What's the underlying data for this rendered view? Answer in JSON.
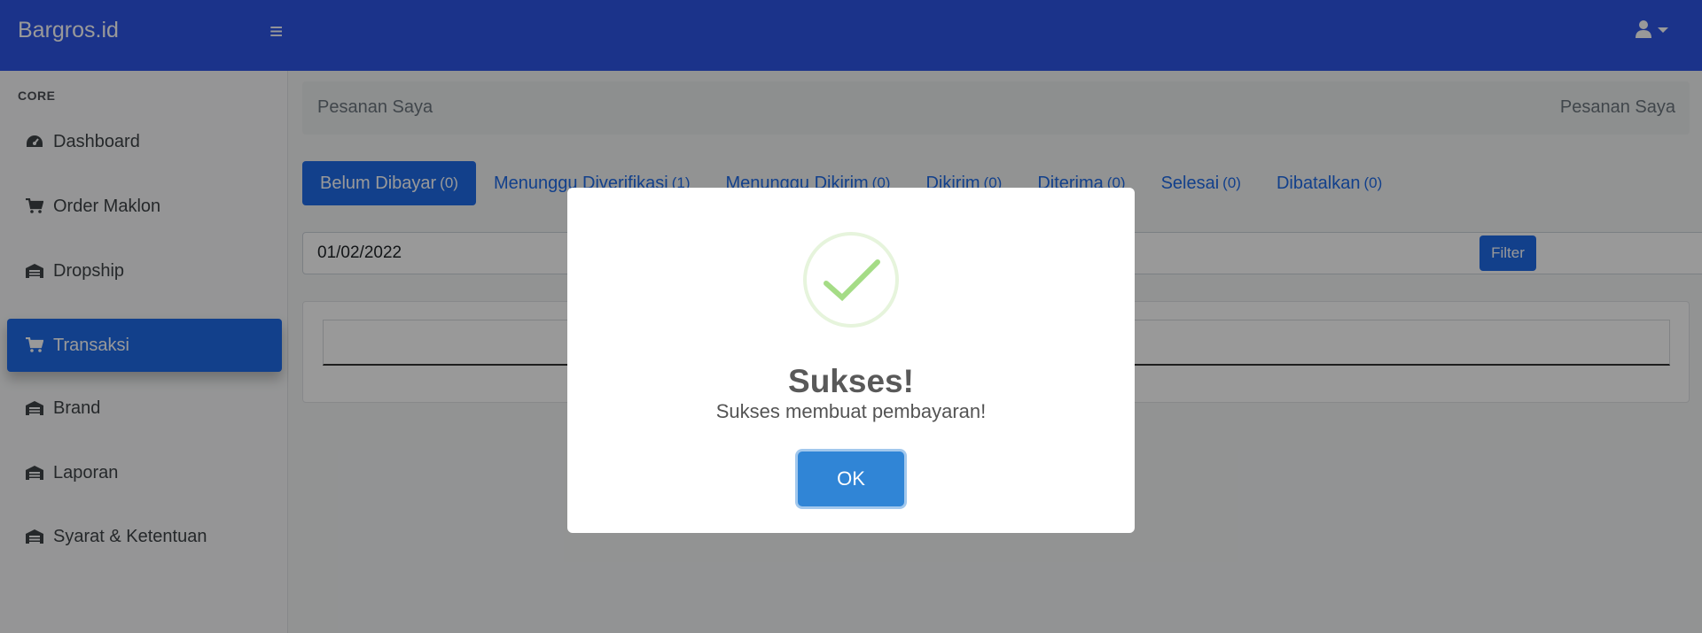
{
  "app": {
    "brand": "Bargros.id",
    "menu_icon": "hamburger-icon",
    "user_icon": "user-icon"
  },
  "colors": {
    "navbar": "#2e55e6",
    "accent": "#1f6be8",
    "ok_button": "#3085d6",
    "success_check": "#a5dc86"
  },
  "sidebar": {
    "heading": "CORE",
    "items": [
      {
        "label": "Dashboard",
        "icon": "dashboard-icon",
        "active": false
      },
      {
        "label": "Order Maklon",
        "icon": "cart-icon",
        "active": false
      },
      {
        "label": "Dropship",
        "icon": "warehouse-icon",
        "active": false
      },
      {
        "label": "Transaksi",
        "icon": "cart-icon",
        "active": true
      },
      {
        "label": "Brand",
        "icon": "warehouse-icon",
        "active": false
      },
      {
        "label": "Laporan",
        "icon": "warehouse-icon",
        "active": false
      },
      {
        "label": "Syarat & Ketentuan",
        "icon": "warehouse-icon",
        "active": false
      }
    ]
  },
  "breadcrumb": {
    "left": "Pesanan Saya",
    "right": "Pesanan Saya"
  },
  "tabs": [
    {
      "label": "Belum Dibayar",
      "count": "(0)",
      "active": true
    },
    {
      "label": "Menunggu Diverifikasi",
      "count": "(1)",
      "active": false
    },
    {
      "label": "Menunggu Dikirim",
      "count": "(0)",
      "active": false
    },
    {
      "label": "Dikirim",
      "count": "(0)",
      "active": false
    },
    {
      "label": "Diterima",
      "count": "(0)",
      "active": false
    },
    {
      "label": "Selesai",
      "count": "(0)",
      "active": false
    },
    {
      "label": "Dibatalkan",
      "count": "(0)",
      "active": false
    }
  ],
  "filters": {
    "date_from": "01/02/2022",
    "filter_label": "Filter"
  },
  "modal": {
    "icon": "success-check-icon",
    "title": "Sukses!",
    "text": "Sukses membuat pembayaran!",
    "ok_label": "OK"
  }
}
